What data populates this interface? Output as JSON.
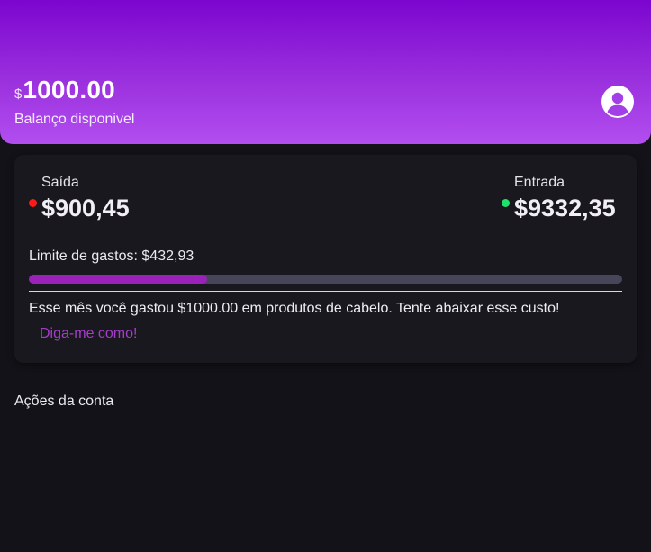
{
  "header": {
    "currency_symbol": "$",
    "balance": "1000.00",
    "balance_label": "Balanço disponivel",
    "gradient": [
      "#7c05cf",
      "#b24ef0"
    ],
    "avatar_icon": "user-circle-icon"
  },
  "summary": {
    "outflow": {
      "label": "Saída",
      "value": "$900,45",
      "dot_color": "#ff1a1a"
    },
    "inflow": {
      "label": "Entrada",
      "value": "$9332,35",
      "dot_color": "#1ee36a"
    },
    "limit_text": "Limite de gastos: $432,93",
    "progress_percent": 30,
    "progress_color": "#9b22b8",
    "message": "Esse mês você gastou $1000.00 em produtos de cabelo. Tente abaixar esse custo!",
    "cta_label": "Diga-me como!"
  },
  "sections": {
    "account_actions_title": "Ações da conta"
  }
}
